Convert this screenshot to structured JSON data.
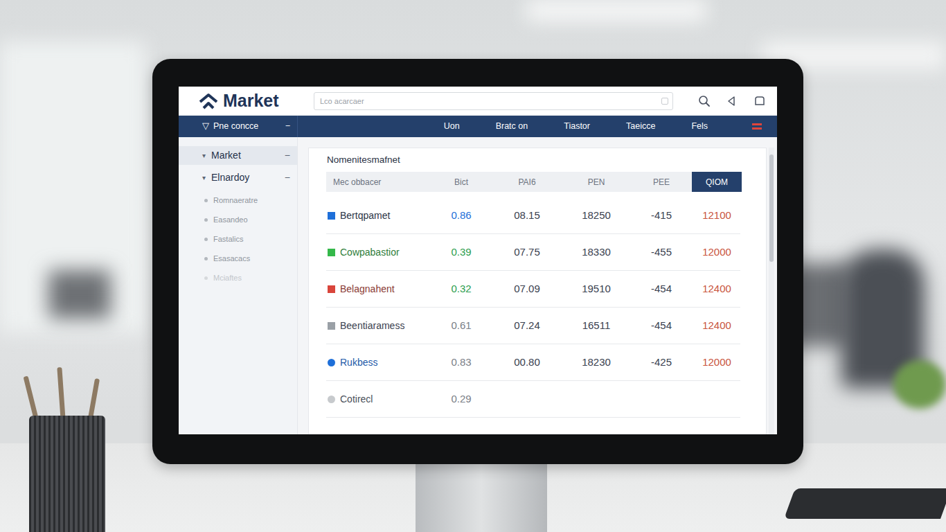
{
  "header": {
    "logo": "Market",
    "search": {
      "placeholder": "Lco acarcaer"
    }
  },
  "navbar": {
    "menu": {
      "icon": "▽",
      "label": "Pne concce",
      "toggle": "−"
    },
    "items": [
      "Uon",
      "Bratc on",
      "Tiastor",
      "Taeicce",
      "Fels"
    ]
  },
  "sidebar": {
    "items": [
      {
        "kind": "group",
        "icon": "▾",
        "label": "Market",
        "toggle": "−",
        "selected": true,
        "disabled": false
      },
      {
        "kind": "group",
        "icon": "▾",
        "label": "Elnardoy",
        "toggle": "−",
        "selected": false,
        "disabled": false
      },
      {
        "kind": "link",
        "label": "Romnaeratre",
        "selected": false,
        "disabled": false
      },
      {
        "kind": "link",
        "label": "Easandeo",
        "selected": false,
        "disabled": false
      },
      {
        "kind": "link",
        "label": "Fastalics",
        "selected": false,
        "disabled": false
      },
      {
        "kind": "link",
        "label": "Esasacacs",
        "selected": false,
        "disabled": false
      },
      {
        "kind": "link",
        "label": "Mciaftes",
        "selected": false,
        "disabled": true
      }
    ]
  },
  "panel": {
    "title": "Nomenitesmafnet"
  },
  "table": {
    "columns": [
      {
        "label": "Mec obbacer",
        "selected": false
      },
      {
        "label": "Bict",
        "selected": false
      },
      {
        "label": "PAI6",
        "selected": false
      },
      {
        "label": "PEN",
        "selected": false
      },
      {
        "label": "PEE",
        "selected": false
      },
      {
        "label": "QIOM",
        "selected": true
      }
    ],
    "rows": [
      {
        "kind": "square",
        "color": "#1e6fd9",
        "name_color": "#2b3445",
        "bid_color": "#1e6fd9",
        "cells": [
          "Bertqpamet",
          "0.86",
          "08.15",
          "18250",
          "-415",
          "12100"
        ]
      },
      {
        "kind": "square",
        "color": "#34b84a",
        "name_color": "#2f7d3a",
        "bid_color": "#2e9e4f",
        "cells": [
          "Cowpabastior",
          "0.39",
          "07.75",
          "18330",
          "-455",
          "12000"
        ]
      },
      {
        "kind": "square",
        "color": "#d9453b",
        "name_color": "#8a3a34",
        "bid_color": "#2e9e4f",
        "cells": [
          "Belagnahent",
          "0.32",
          "07.09",
          "19510",
          "-454",
          "12400"
        ]
      },
      {
        "kind": "square",
        "color": "#9aa0a6",
        "name_color": "#3b4250",
        "bid_color": "#7b8088",
        "cells": [
          "Beentiaramess",
          "0.61",
          "07.24",
          "16511",
          "-454",
          "12400"
        ]
      },
      {
        "kind": "circle",
        "color": "#1e6fd9",
        "name_color": "#1e5aa8",
        "bid_color": "#7b8088",
        "cells": [
          "Rukbess",
          "0.83",
          "00.80",
          "18230",
          "-425",
          "12000"
        ]
      },
      {
        "kind": "circle",
        "color": "#c7cacd",
        "name_color": "#4a505a",
        "bid_color": "#7b8088",
        "cells": [
          "Cotirecl",
          "0.29"
        ]
      }
    ]
  }
}
